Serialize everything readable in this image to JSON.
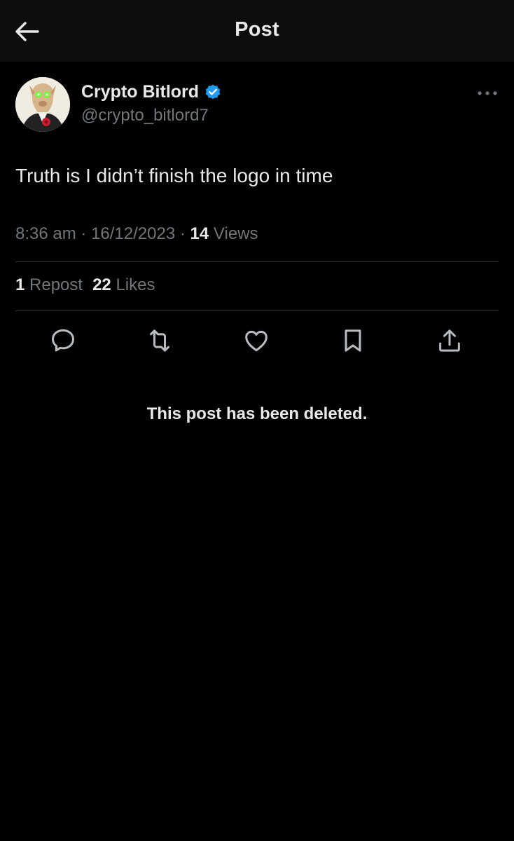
{
  "header": {
    "title": "Post",
    "back_icon": "arrow-left-icon"
  },
  "author": {
    "display_name": "Crypto Bitlord",
    "handle": "@crypto_bitlord7",
    "verified": true,
    "verified_color": "#1d9bf0",
    "avatar_icon": "avatar-image"
  },
  "post": {
    "text": "Truth is I didn’t finish the logo in time",
    "time": "8:36 am",
    "separator": "·",
    "date": "16/12/2023",
    "views_count": "14",
    "views_label": "Views"
  },
  "stats": {
    "reposts_count": "1",
    "reposts_label": "Repost",
    "likes_count": "22",
    "likes_label": "Likes"
  },
  "actions": [
    {
      "name": "reply",
      "icon": "comment-icon"
    },
    {
      "name": "repost",
      "icon": "repost-icon"
    },
    {
      "name": "like",
      "icon": "heart-icon"
    },
    {
      "name": "bookmark",
      "icon": "bookmark-icon"
    },
    {
      "name": "share",
      "icon": "share-icon"
    }
  ],
  "deleted_notice": "This post has been deleted.",
  "colors": {
    "background": "#000000",
    "header_background": "#0d0d0d",
    "primary_text": "#e7e9ea",
    "secondary_text": "#71767b",
    "divider": "#2f3336",
    "icon": "#b8bcc0"
  }
}
